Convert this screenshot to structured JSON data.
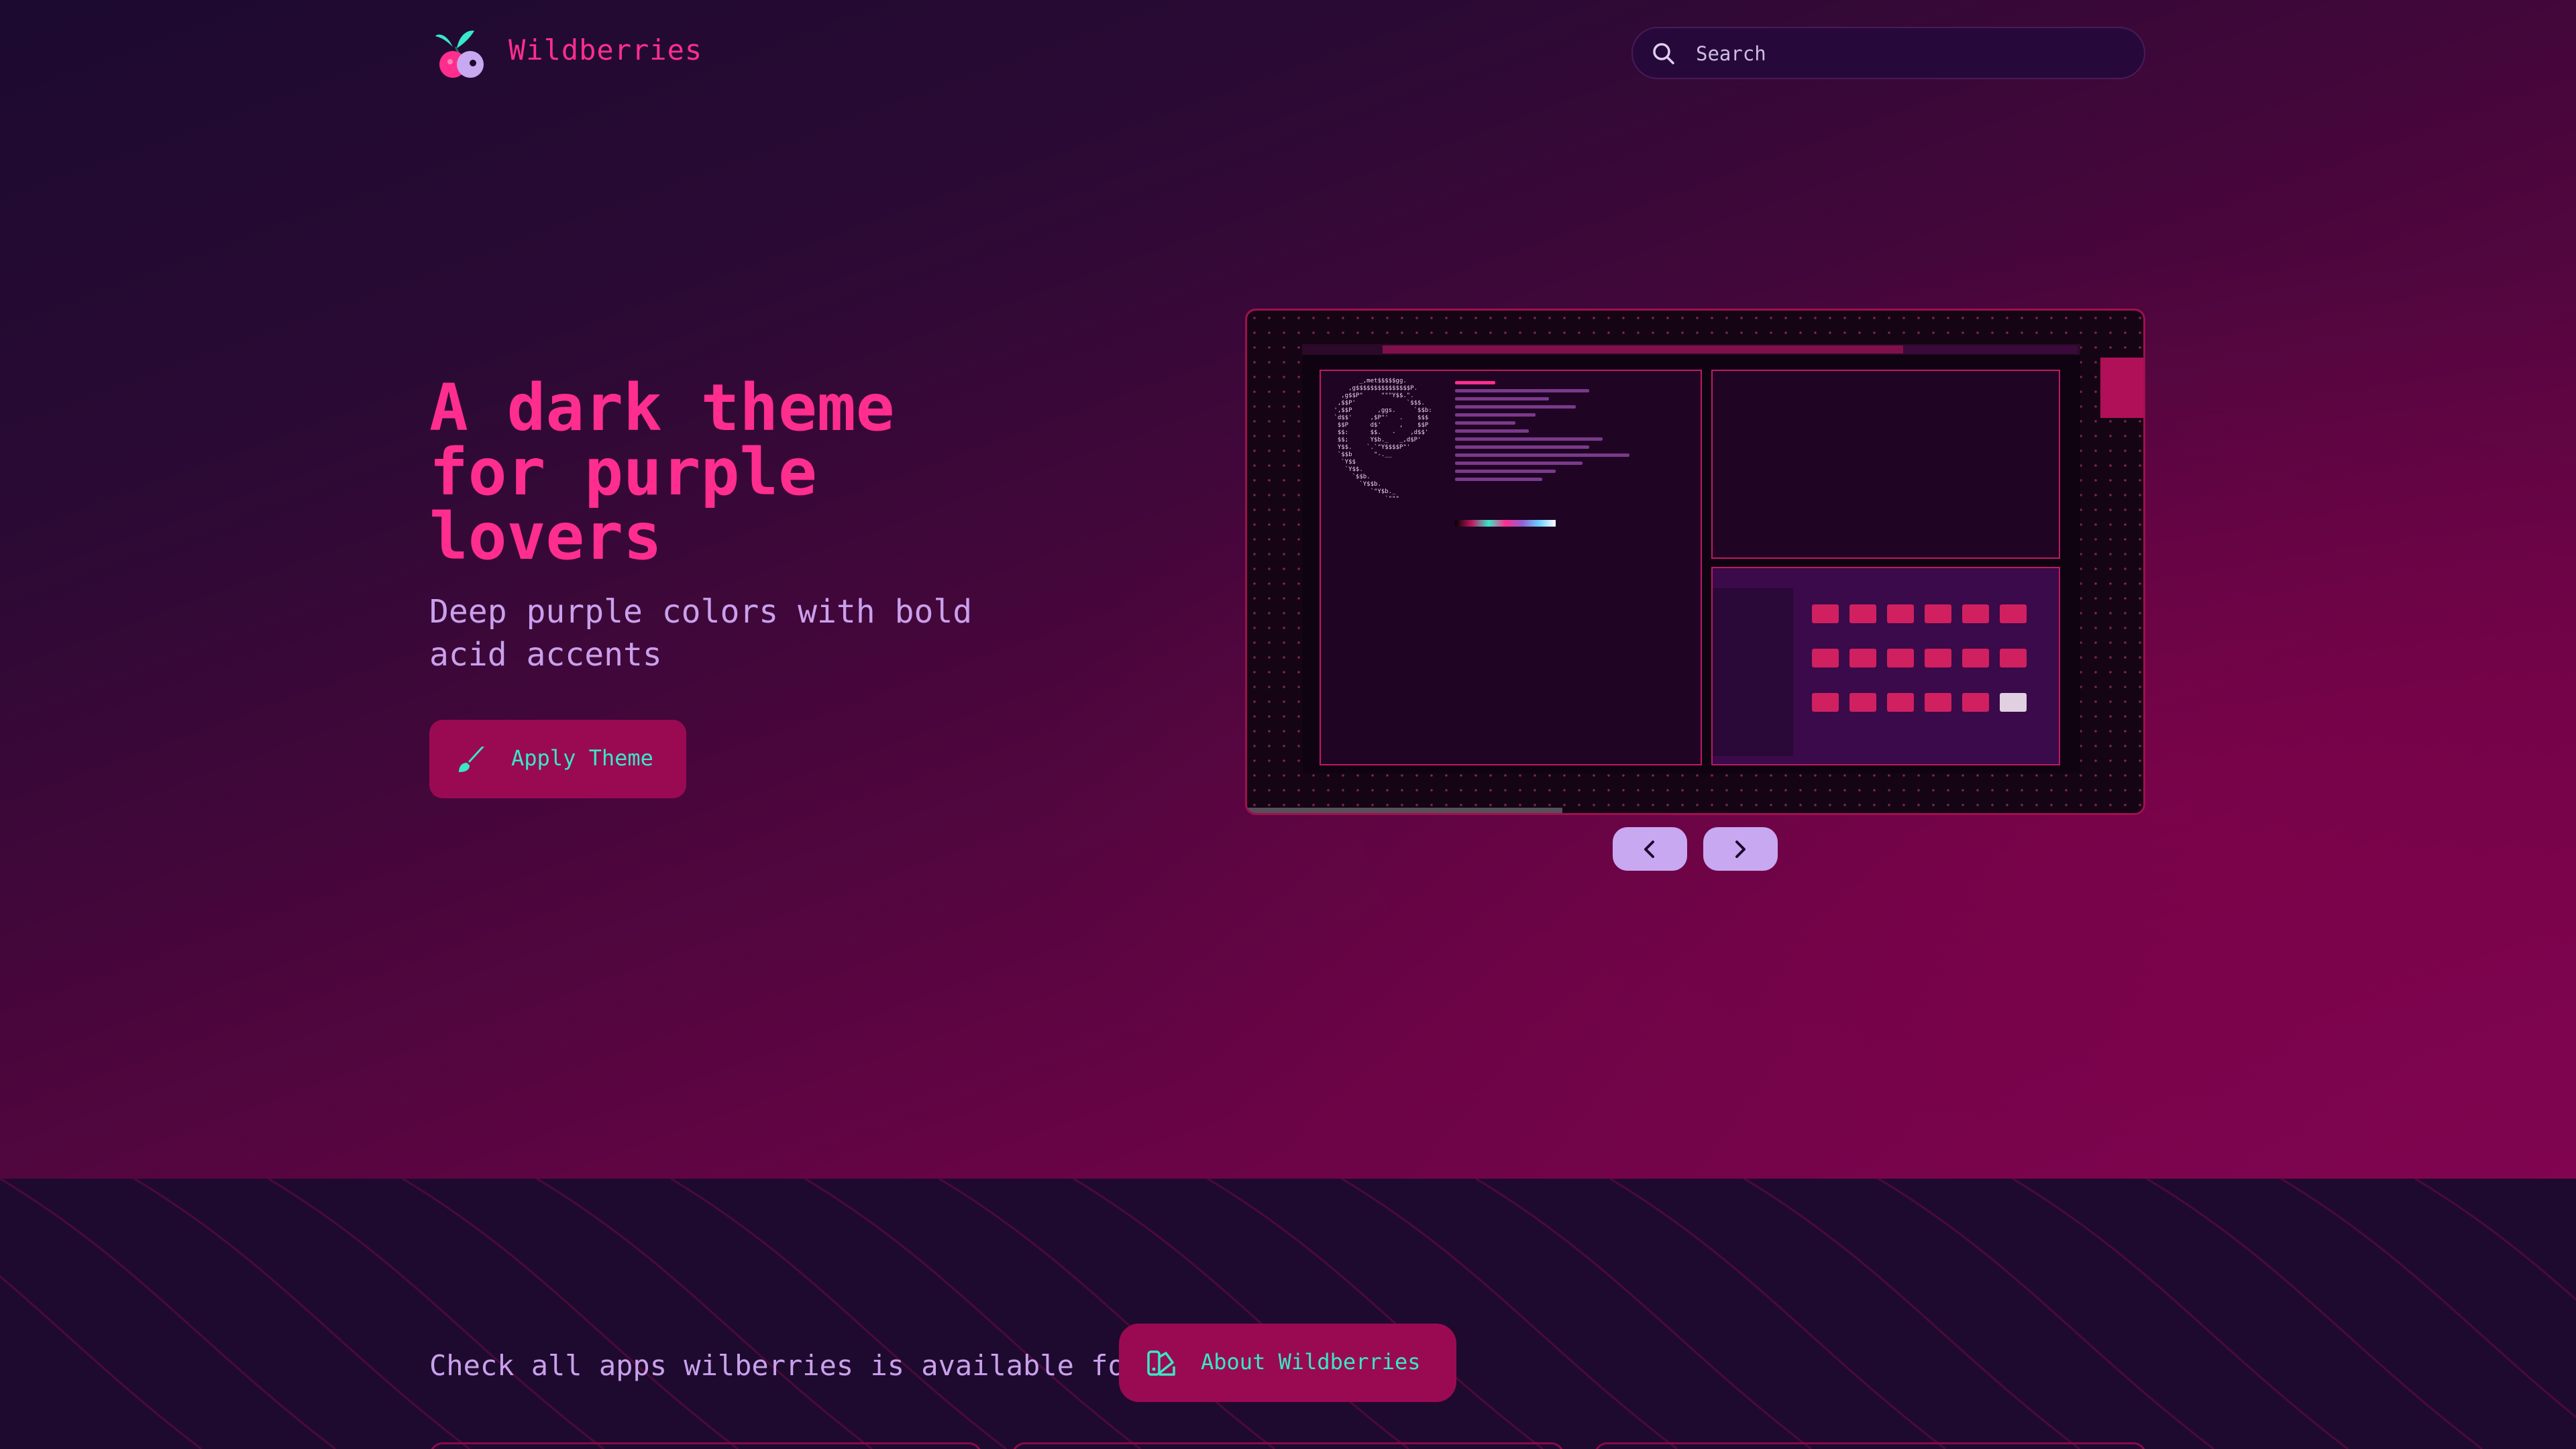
{
  "header": {
    "brand": "Wildberries",
    "search_placeholder": "Search"
  },
  "hero": {
    "headline": "A dark theme for purple lovers",
    "subline": "Deep purple colors with bold acid accents",
    "apply_label": "Apply Theme"
  },
  "carousel": {
    "prev_icon": "chevron-left-icon",
    "next_icon": "chevron-right-icon"
  },
  "apps": {
    "check_text": "Check all apps wilberries is available for:",
    "about_label": "About Wildberries"
  },
  "colors": {
    "accent_pink": "#ff2e8e",
    "accent_teal": "#38e8c8",
    "button_bg": "#9a0a52",
    "lavender": "#c8a8f0"
  }
}
